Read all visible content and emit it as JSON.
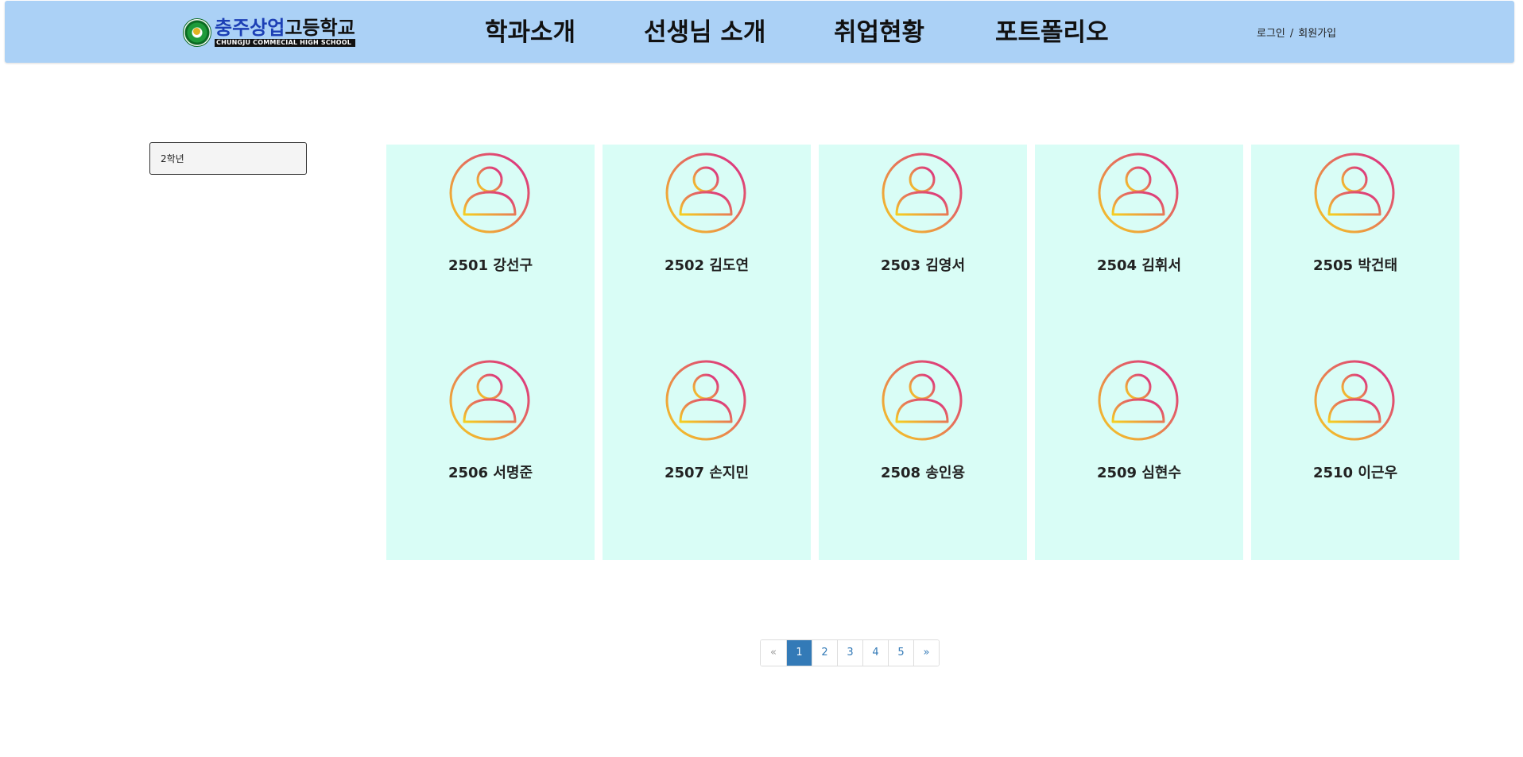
{
  "header": {
    "logo": {
      "title_part1": "충주상업",
      "title_part2": "고등학교",
      "subtitle": "CHUNGJU COMMECIAL HIGH SCHOOL"
    },
    "nav": [
      "학과소개",
      "선생님 소개",
      "취업현황",
      "포트폴리오"
    ],
    "auth": {
      "login": "로그인",
      "separator": "/",
      "signup": "회원가입"
    }
  },
  "sidebar": {
    "grade_filter": "2학년"
  },
  "students": [
    "2501 강선구",
    "2502 김도연",
    "2503 김영서",
    "2504 김휘서",
    "2505 박건태",
    "2506 서명준",
    "2507 손지민",
    "2508 송인용",
    "2509 심현수",
    "2510 이근우"
  ],
  "pagination": {
    "prev": "«",
    "pages": [
      "1",
      "2",
      "3",
      "4",
      "5"
    ],
    "next": "»",
    "active": "1"
  },
  "colors": {
    "header_bg": "#abd1f6",
    "card_bg": "#d9fdf6",
    "avatar_gradient": [
      "#f5d020",
      "#d9248a"
    ],
    "pager_active": "#337ab7"
  }
}
